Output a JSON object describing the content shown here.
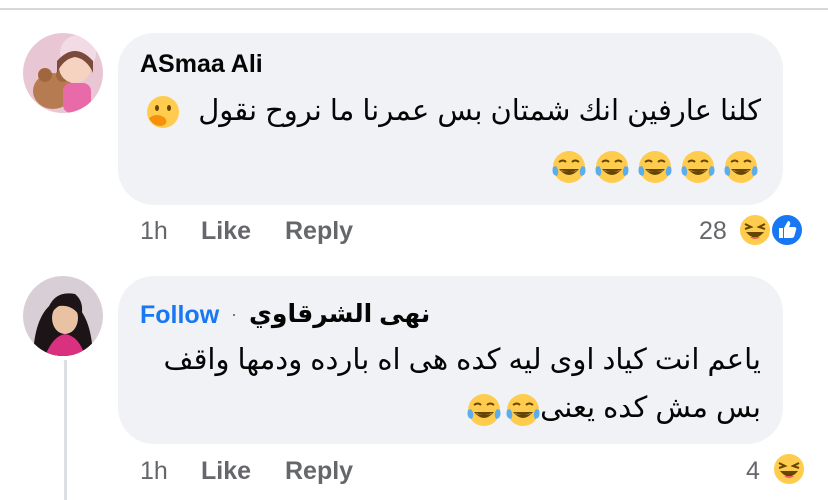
{
  "comments": [
    {
      "author": "ASmaa Ali",
      "text_line1": "كلنا عارفين انك شمتان بس عمرنا ما نروح نقول",
      "emoji_row_count": 5,
      "time": "1h",
      "like_label": "Like",
      "reply_label": "Reply",
      "reaction_count": "28",
      "reactions": [
        "laughing-face-icon",
        "like-thumb-icon"
      ],
      "inline_emoji": "hand-over-mouth-face-icon"
    },
    {
      "author": "نهى الشرقاوي",
      "follow_label": "Follow",
      "separator": "·",
      "text_line1": "ياعم انت كياد اوى ليه كده هى اه بارده ودمها واقف",
      "text_line2": "بس مش كده يعنى",
      "time": "1h",
      "like_label": "Like",
      "reply_label": "Reply",
      "reaction_count": "4",
      "reactions": [
        "laughing-face-icon"
      ]
    }
  ],
  "colors": {
    "bubble": "#f0f2f5",
    "meta_text": "#65676b",
    "link_blue": "#1877f2",
    "emoji_yellow": "#ffcc4d"
  }
}
